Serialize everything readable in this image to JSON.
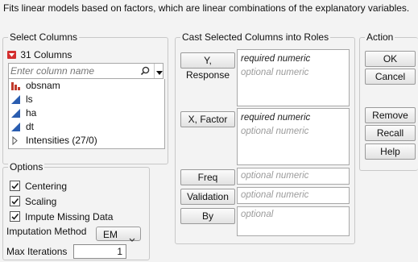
{
  "description": "Fits linear models based on factors, which are linear combinations of the explanatory variables.",
  "select_columns": {
    "title": "Select Columns",
    "count_label": "31 Columns",
    "search_placeholder": "Enter column name",
    "items": [
      {
        "label": "obsnam",
        "icon": "nominal-bar-icon"
      },
      {
        "label": "ls",
        "icon": "continuous-triangle-icon"
      },
      {
        "label": "ha",
        "icon": "continuous-triangle-icon"
      },
      {
        "label": "dt",
        "icon": "continuous-triangle-icon"
      },
      {
        "label": "Intensities (27/0)",
        "icon": "expand-triangle-icon"
      }
    ]
  },
  "cast_roles": {
    "title": "Cast Selected Columns into Roles",
    "roles": [
      {
        "button": "Y, Response",
        "line1": "required numeric",
        "line2": "optional numeric"
      },
      {
        "button": "X, Factor",
        "line1": "required numeric",
        "line2": "optional numeric"
      },
      {
        "button": "Freq",
        "line1": "optional numeric"
      },
      {
        "button": "Validation",
        "line1": "optional numeric"
      },
      {
        "button": "By",
        "line1": "optional"
      }
    ]
  },
  "action": {
    "title": "Action",
    "ok": "OK",
    "cancel": "Cancel",
    "remove": "Remove",
    "recall": "Recall",
    "help": "Help"
  },
  "options": {
    "title": "Options",
    "centering": "Centering",
    "scaling": "Scaling",
    "impute": "Impute Missing Data",
    "imputation_label": "Imputation Method",
    "imputation_value": "EM",
    "max_iter_label": "Max Iterations",
    "max_iter_value": "1"
  },
  "colors": {
    "nominal_icon": "#c0392b",
    "continuous_icon": "#2a5db0",
    "menu_arrow": "#d32f2f",
    "check": "#1a1a1a"
  }
}
